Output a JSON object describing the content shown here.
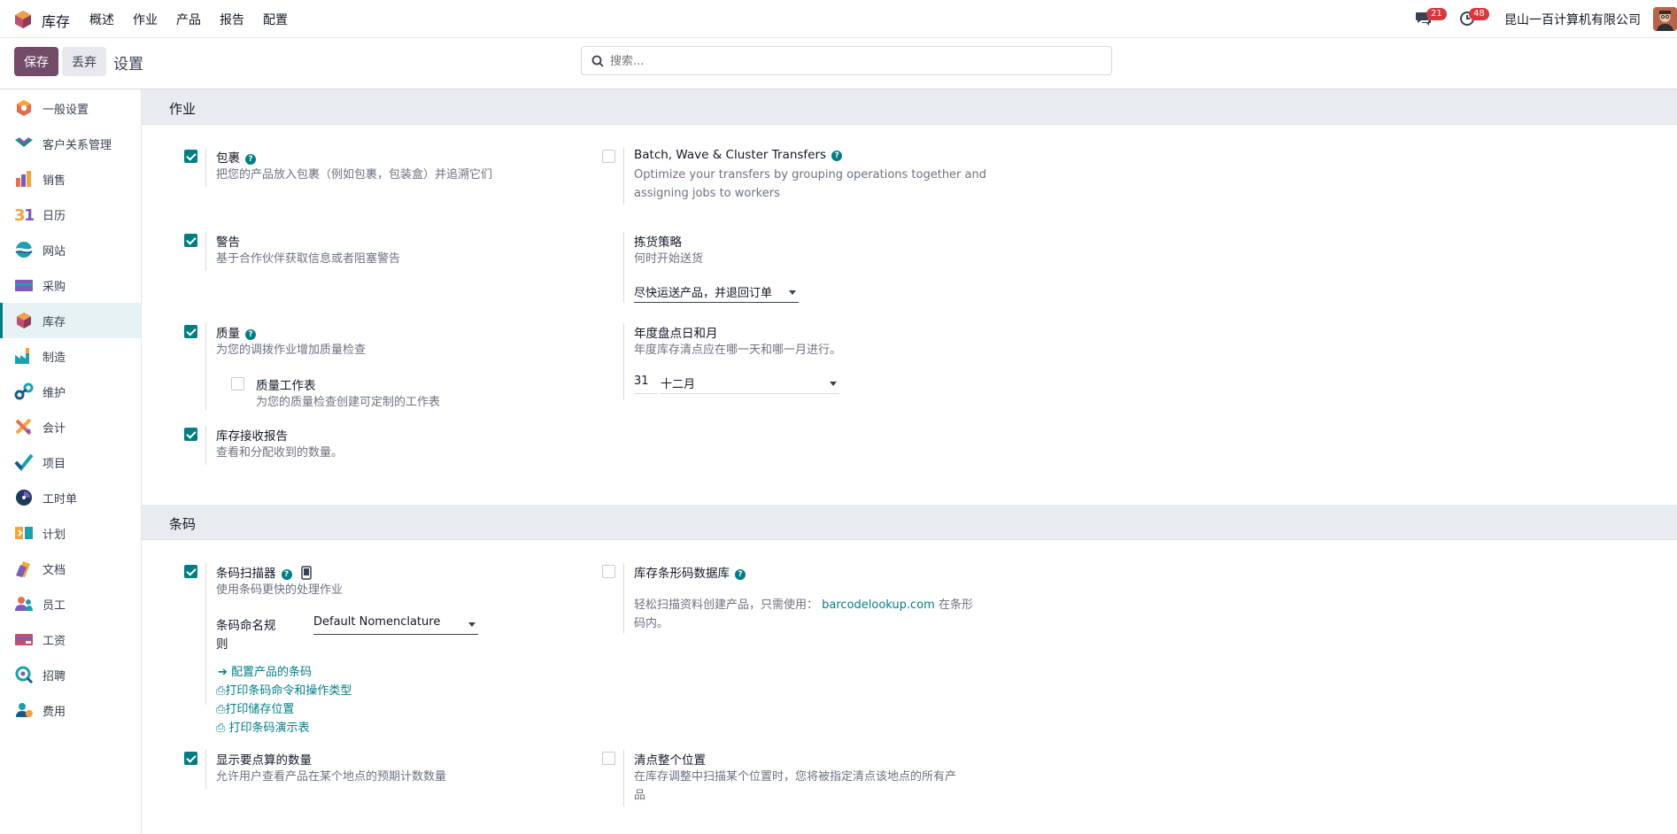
{
  "topbar": {
    "app_name": "库存",
    "menu": [
      "概述",
      "作业",
      "产品",
      "报告",
      "配置"
    ],
    "messages_badge": "21",
    "activities_badge": "48",
    "company": "昆山一百计算机有限公司"
  },
  "control": {
    "save": "保存",
    "discard": "丢弃",
    "title": "设置",
    "search_placeholder": "搜索..."
  },
  "sidebar": {
    "items": [
      {
        "label": "一般设置",
        "icon": "general-settings-icon"
      },
      {
        "label": "客户关系管理",
        "icon": "crm-icon"
      },
      {
        "label": "销售",
        "icon": "sales-icon"
      },
      {
        "label": "日历",
        "icon": "calendar-icon"
      },
      {
        "label": "网站",
        "icon": "website-icon"
      },
      {
        "label": "采购",
        "icon": "purchase-icon"
      },
      {
        "label": "库存",
        "icon": "inventory-icon"
      },
      {
        "label": "制造",
        "icon": "manufacturing-icon"
      },
      {
        "label": "维护",
        "icon": "maintenance-icon"
      },
      {
        "label": "会计",
        "icon": "accounting-icon"
      },
      {
        "label": "项目",
        "icon": "project-icon"
      },
      {
        "label": "工时单",
        "icon": "timesheet-icon"
      },
      {
        "label": "计划",
        "icon": "planning-icon"
      },
      {
        "label": "文档",
        "icon": "documents-icon"
      },
      {
        "label": "员工",
        "icon": "employees-icon"
      },
      {
        "label": "工资",
        "icon": "payroll-icon"
      },
      {
        "label": "招聘",
        "icon": "recruitment-icon"
      },
      {
        "label": "费用",
        "icon": "expenses-icon"
      }
    ],
    "active": "库存"
  },
  "sections": {
    "operations": {
      "title": "作业",
      "packages": {
        "title": "包裹",
        "desc": "把您的产品放入包裹（例如包裹，包装盒）并追溯它们",
        "checked": true
      },
      "batch": {
        "title": "Batch, Wave & Cluster Transfers",
        "desc1": "Optimize your transfers by grouping operations together and",
        "desc2": "assigning jobs to workers",
        "checked": false
      },
      "warnings": {
        "title": "警告",
        "desc": "基于合作伙伴获取信息或者阻塞警告",
        "checked": true
      },
      "picking": {
        "title": "拣货策略",
        "desc": "何时开始送货",
        "value": "尽快运送产品，并退回订单"
      },
      "quality": {
        "title": "质量",
        "desc": "为您的调拨作业增加质量检查",
        "checked": true
      },
      "quality_worksheet": {
        "title": "质量工作表",
        "desc": "为您的质量检查创建可定制的工作表",
        "checked": false
      },
      "annual": {
        "title": "年度盘点日和月",
        "desc": "年度库存清点应在哪一天和哪一月进行。",
        "day": "31",
        "month": "十二月"
      },
      "reception": {
        "title": "库存接收报告",
        "desc": "查看和分配收到的数量。",
        "checked": true
      }
    },
    "barcode": {
      "title": "条码",
      "scanner": {
        "title": "条码扫描器",
        "desc": "使用条码更快的处理作业",
        "checked": true,
        "nomenclature_label1": "条码命名规",
        "nomenclature_label2": "则",
        "nomenclature_value": "Default Nomenclature"
      },
      "links": {
        "configure": "配置产品的条码",
        "print_commands": "打印条码命令和操作类型",
        "print_locations": "打印储存位置",
        "print_demo": "打印条码演示表"
      },
      "database": {
        "title": "库存条形码数据库",
        "desc_pre": "轻松扫描资料创建产品，只需使用：",
        "link": "barcodelookup.com",
        "desc_post": "在条形",
        "desc_line2": "码内。",
        "checked": false
      },
      "show_quantities": {
        "title": "显示要点算的数量",
        "desc": "允许用户查看产品在某个地点的预期计数数量",
        "checked": true
      },
      "count_location": {
        "title": "清点整个位置",
        "desc1": "在库存调整中扫描某个位置时，您将被指定清点该地点的所有产",
        "desc2": "品",
        "checked": false
      }
    }
  },
  "colors": {
    "primary": "#714b67",
    "accent": "#017e84",
    "section_bg": "#e9ecef"
  }
}
